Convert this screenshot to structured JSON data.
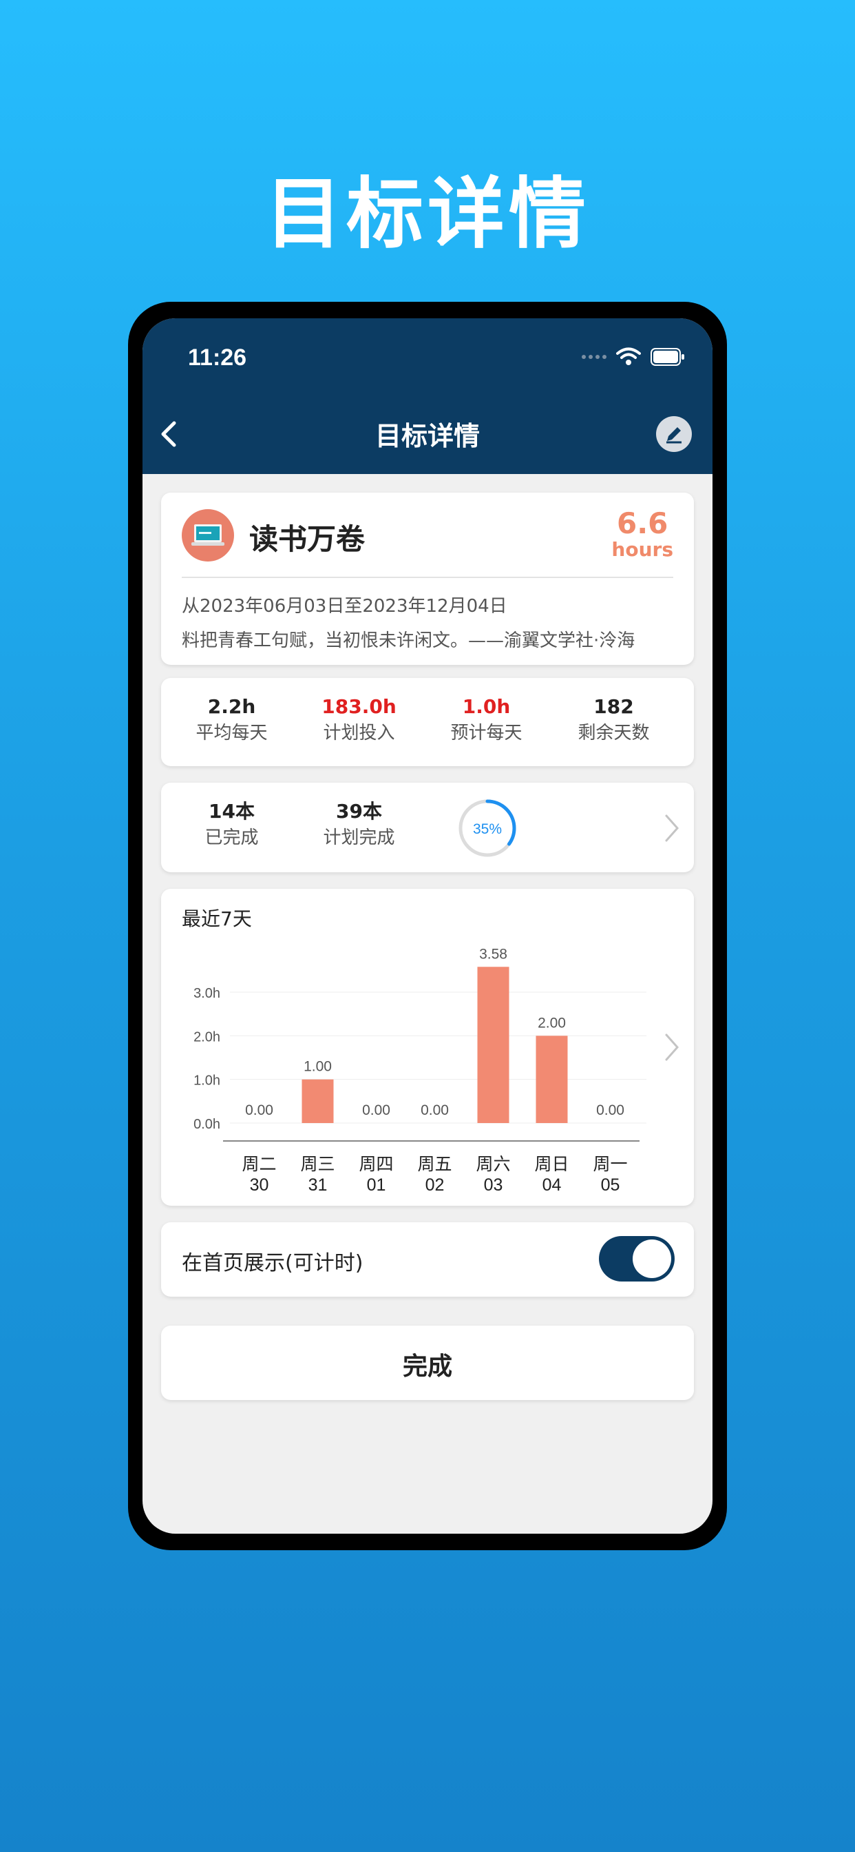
{
  "promo": {
    "title": "目标详情"
  },
  "status_bar": {
    "time": "11:26"
  },
  "nav": {
    "title": "目标详情"
  },
  "goal": {
    "name": "读书万卷",
    "value": "6.6",
    "unit": "hours",
    "dates": "从2023年06月03日至2023年12月04日",
    "quote": "料把青春工句赋，当初恨未许闲文。——渝翼文学社·泠海"
  },
  "stats": [
    {
      "value": "2.2h",
      "label": "平均每天",
      "color": "#222222"
    },
    {
      "value": "183.0h",
      "label": "计划投入",
      "color": "#e02020"
    },
    {
      "value": "1.0h",
      "label": "预计每天",
      "color": "#e02020"
    },
    {
      "value": "182",
      "label": "剩余天数",
      "color": "#222222"
    }
  ],
  "books": {
    "completed_value": "14本",
    "completed_label": "已完成",
    "planned_value": "39本",
    "planned_label": "计划完成",
    "progress_label": "35%",
    "progress": 0.35
  },
  "chart_data": {
    "type": "bar",
    "title": "最近7天",
    "categories": [
      "周二\n30",
      "周三\n31",
      "周四\n01",
      "周五\n02",
      "周六\n03",
      "周日\n04",
      "周一\n05"
    ],
    "weekdays": [
      "周二",
      "周三",
      "周四",
      "周五",
      "周六",
      "周日",
      "周一"
    ],
    "days": [
      "30",
      "31",
      "01",
      "02",
      "03",
      "04",
      "05"
    ],
    "values": [
      0.0,
      1.0,
      0.0,
      0.0,
      3.58,
      2.0,
      0.0
    ],
    "value_labels": [
      "0.00",
      "1.00",
      "0.00",
      "0.00",
      "3.58",
      "2.00",
      "0.00"
    ],
    "yticks": [
      "0.0h",
      "1.0h",
      "2.0h",
      "3.0h"
    ],
    "ylim": [
      0,
      3.6
    ],
    "bar_color": "#f28a72",
    "grid": true
  },
  "toggle": {
    "label": "在首页展示(可计时)",
    "on": true
  },
  "done": {
    "label": "完成"
  },
  "colors": {
    "nav": "#0c3c63",
    "accent": "#f08a6a",
    "ring": "#1e90f0"
  }
}
